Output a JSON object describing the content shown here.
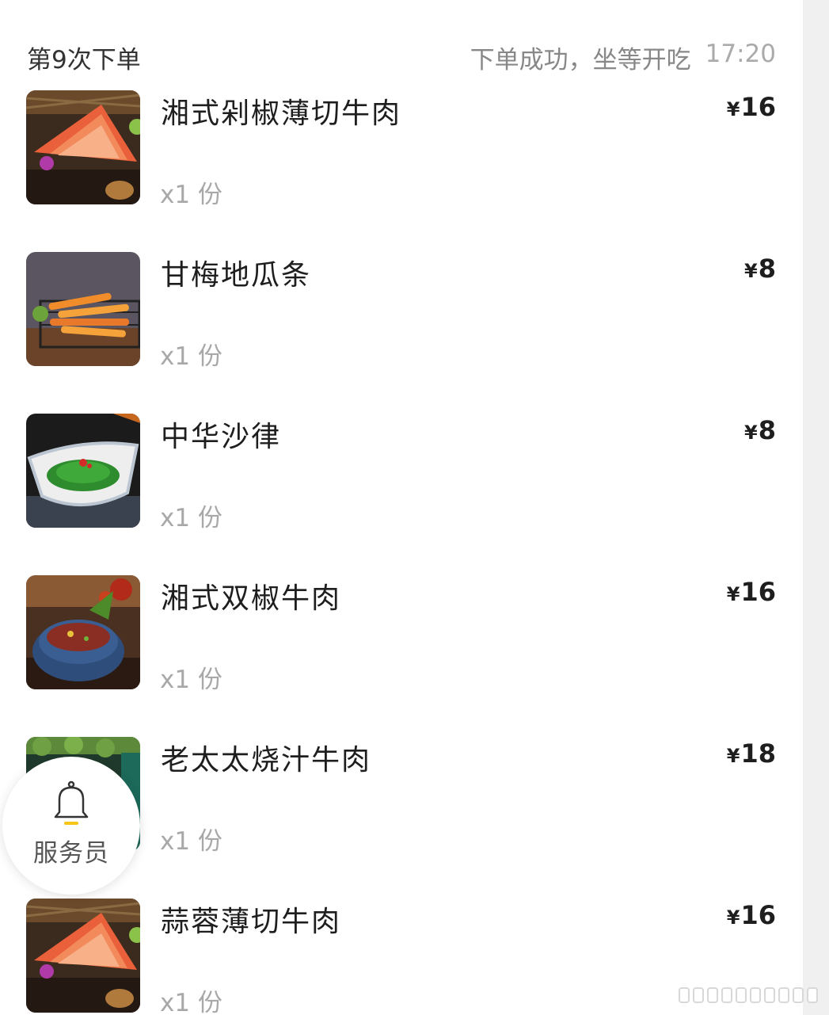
{
  "order": {
    "title": "第9次下单",
    "status": "下单成功，坐等开吃",
    "time": "17:20"
  },
  "currency_symbol": "¥",
  "items": [
    {
      "name": "湘式剁椒薄切牛肉",
      "price": "16",
      "qty": "x1 份",
      "thumb_icon": "sliced-beef-dish-photo"
    },
    {
      "name": "甘梅地瓜条",
      "price": "8",
      "qty": "x1 份",
      "thumb_icon": "sweet-potato-fries-photo"
    },
    {
      "name": "中华沙律",
      "price": "8",
      "qty": "x1 份",
      "thumb_icon": "seaweed-salad-photo"
    },
    {
      "name": "湘式双椒牛肉",
      "price": "16",
      "qty": "x1 份",
      "thumb_icon": "chili-beef-bowl-photo"
    },
    {
      "name": "老太太烧汁牛肉",
      "price": "18",
      "qty": "x1 份",
      "thumb_icon": "braised-beef-photo"
    },
    {
      "name": "蒜蓉薄切牛肉",
      "price": "16",
      "qty": "x1 份",
      "thumb_icon": "sliced-beef-dish-photo"
    }
  ],
  "waiter": {
    "label": "服务员",
    "icon": "bell-icon",
    "accent": "#f5c518"
  }
}
